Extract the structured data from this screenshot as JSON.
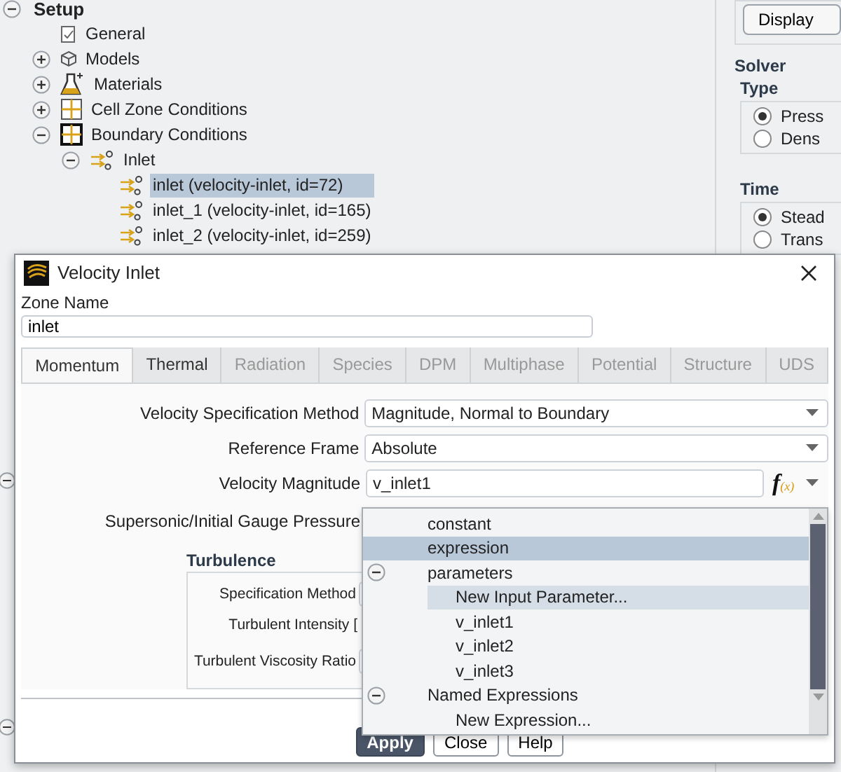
{
  "tree": [
    {
      "label": "Setup",
      "kind": "root",
      "expanded": true,
      "selected": false,
      "children": [
        {
          "label": "General",
          "kind": "page",
          "selected": false
        },
        {
          "label": "Models",
          "kind": "cube",
          "expanded": false,
          "selected": false
        },
        {
          "label": "Materials",
          "kind": "flask",
          "expanded": false,
          "selected": false
        },
        {
          "label": "Cell Zone Conditions",
          "kind": "grid",
          "expanded": false,
          "selected": false
        },
        {
          "label": "Boundary Conditions",
          "kind": "grid-bold",
          "expanded": true,
          "selected": false,
          "children": [
            {
              "label": "Inlet",
              "kind": "inlet",
              "expanded": true,
              "selected": false,
              "children": [
                {
                  "label": "inlet (velocity-inlet, id=72)",
                  "kind": "inlet",
                  "selected": true
                },
                {
                  "label": "inlet_1 (velocity-inlet, id=165)",
                  "kind": "inlet",
                  "selected": false
                },
                {
                  "label": "inlet_2 (velocity-inlet, id=259)",
                  "kind": "inlet",
                  "selected": false
                }
              ]
            }
          ]
        }
      ]
    }
  ],
  "side_panel": {
    "button": "Display",
    "title": "Solver",
    "groups": [
      {
        "title": "Type",
        "options": [
          {
            "label": "Press",
            "selected": true
          },
          {
            "label": "Dens",
            "selected": false
          }
        ]
      },
      {
        "title": "Time",
        "options": [
          {
            "label": "Stead",
            "selected": true
          },
          {
            "label": "Trans",
            "selected": false
          }
        ]
      }
    ]
  },
  "dialog": {
    "title": "Velocity Inlet",
    "zone_name_label": "Zone Name",
    "zone_name": "inlet",
    "tabs": [
      {
        "label": "Momentum",
        "selected": true,
        "disabled": false
      },
      {
        "label": "Thermal",
        "selected": false,
        "disabled": false
      },
      {
        "label": "Radiation",
        "selected": false,
        "disabled": true
      },
      {
        "label": "Species",
        "selected": false,
        "disabled": true
      },
      {
        "label": "DPM",
        "selected": false,
        "disabled": true
      },
      {
        "label": "Multiphase",
        "selected": false,
        "disabled": true
      },
      {
        "label": "Potential",
        "selected": false,
        "disabled": true
      },
      {
        "label": "Structure",
        "selected": false,
        "disabled": true
      },
      {
        "label": "UDS",
        "selected": false,
        "disabled": true
      }
    ],
    "fields": [
      {
        "label": "Velocity Specification Method",
        "kind": "dropdown",
        "value": "Magnitude, Normal to Boundary"
      },
      {
        "label": "Reference Frame",
        "kind": "dropdown",
        "value": "Absolute"
      },
      {
        "label": "Velocity Magnitude",
        "kind": "expression",
        "value": "v_inlet1",
        "fx": "f",
        "fx_arg": "(x)"
      },
      {
        "label": "Supersonic/Initial Gauge Pressure",
        "kind": "hidden"
      }
    ],
    "turbulence": {
      "title": "Turbulence",
      "fields": [
        {
          "label": "Specification Method",
          "kind": "dropdown"
        },
        {
          "label": "Turbulent Intensity [",
          "kind": "plain"
        },
        {
          "label": "Turbulent Viscosity Ratio",
          "kind": "input"
        }
      ]
    },
    "buttons": [
      {
        "label": "Apply",
        "kind": "primary"
      },
      {
        "label": "Close",
        "kind": "normal"
      },
      {
        "label": "Help",
        "kind": "normal"
      }
    ]
  },
  "popup": {
    "items": [
      {
        "label": "constant",
        "selected": false,
        "hovered": false
      },
      {
        "label": "expression",
        "selected": true,
        "hovered": false
      },
      {
        "label": "parameters",
        "selected": false,
        "hovered": false,
        "expanded": true,
        "children": [
          {
            "label": "New Input Parameter...",
            "selected": false,
            "hovered": true
          },
          {
            "label": "v_inlet1",
            "selected": false,
            "hovered": false
          },
          {
            "label": "v_inlet2",
            "selected": false,
            "hovered": false
          },
          {
            "label": "v_inlet3",
            "selected": false,
            "hovered": false
          }
        ]
      },
      {
        "label": "Named Expressions",
        "selected": false,
        "hovered": false,
        "expanded": true,
        "children": [
          {
            "label": "New Expression...",
            "selected": false,
            "hovered": false
          }
        ]
      }
    ]
  }
}
